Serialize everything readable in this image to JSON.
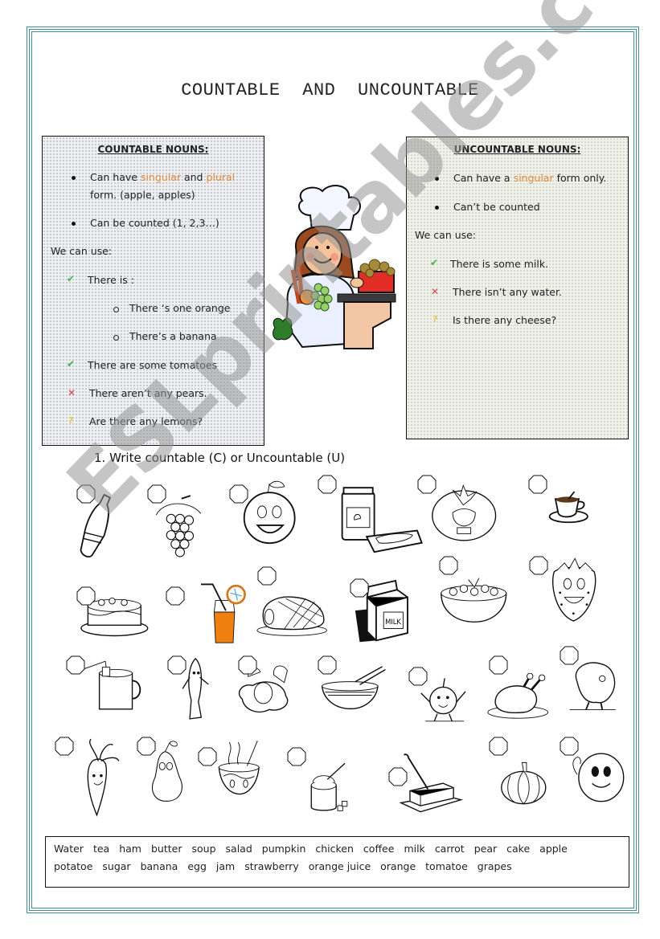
{
  "title": "COUNTABLE   AND   UNCOUNTABLE",
  "colors": {
    "frame_border": "#3f8f95",
    "highlight": "#e38a3b",
    "check": "#46b24a",
    "cross": "#d9454a",
    "question": "#e6c84a",
    "watermark": "#969696"
  },
  "countable": {
    "heading": "COUNTABLE NOUNS:",
    "bullets": [
      {
        "prefix": "Can have ",
        "hl1": "singular",
        "mid": " and ",
        "hl2": "plural",
        "line2": "form.  (apple, apples)"
      },
      {
        "text": "Can be counted (1, 2,3…)"
      }
    ],
    "we_can_use": "We can use:",
    "uses": [
      {
        "mark": "check",
        "symbol": "✔",
        "text": "There is :"
      },
      {
        "mark": "sub",
        "text": "There ‘s one orange"
      },
      {
        "mark": "sub",
        "text": "There’s a banana"
      },
      {
        "mark": "check",
        "symbol": "✔",
        "text": "There are some tomatoes"
      },
      {
        "mark": "cross",
        "symbol": "✕",
        "text": "There aren’t any  pears."
      },
      {
        "mark": "question",
        "symbol": "?",
        "text": "Are there any lemons?"
      }
    ]
  },
  "uncountable": {
    "heading": "UNCOUNTABLE NOUNS:",
    "bullets": [
      {
        "prefix": "Can  have  a  ",
        "hl1": "singular",
        "suffix": "  form  only."
      },
      {
        "text": "Can’t  be counted"
      }
    ],
    "we_can_use": "We can use:",
    "uses": [
      {
        "mark": "check",
        "symbol": "✔",
        "text": "There is some milk."
      },
      {
        "mark": "cross",
        "symbol": "✕",
        "text": "There isn’t any water."
      },
      {
        "mark": "question",
        "symbol": "?",
        "text": "Is  there any cheese?"
      }
    ]
  },
  "illustration": {
    "label": "chef-with-food"
  },
  "exercise": {
    "instruction": "1. Write countable (C) or Uncountable (U)",
    "pictures": [
      "water-bottle",
      "grapes",
      "orange",
      "jam",
      "tomato",
      "coffee",
      "cake",
      "orange-juice",
      "ham",
      "milk",
      "salad",
      "strawberry",
      "tea",
      "banana",
      "egg",
      "soup-bowl",
      "apple",
      "chicken",
      "potato",
      "carrot",
      "pear",
      "soup",
      "sugar",
      "butter",
      "pumpkin",
      "lemon"
    ]
  },
  "word_bank": {
    "row1": [
      "Water",
      "tea",
      "ham",
      "butter",
      "soup",
      "salad",
      "pumpkin",
      "chicken",
      "coffee",
      "milk",
      "carrot",
      "pear",
      "cake",
      "apple"
    ],
    "row2": [
      "potatoe",
      "sugar",
      "banana",
      "egg",
      "jam",
      "strawberry",
      "orange juice",
      "orange",
      "tomatoe",
      "grapes"
    ]
  },
  "watermark": "ESLprintables.com"
}
